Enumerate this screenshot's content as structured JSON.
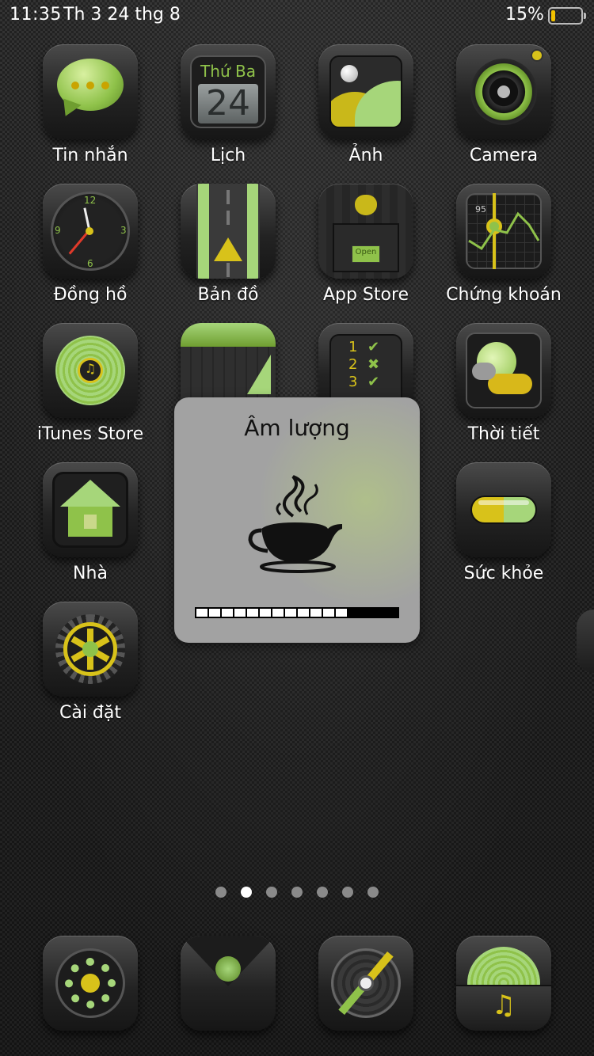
{
  "status_bar": {
    "time": "11:35",
    "date": "Th 3 24 thg 8",
    "battery_percent": "15%",
    "battery_level": 0.15
  },
  "apps": [
    {
      "label": "Tin nhắn",
      "icon": "messages-icon"
    },
    {
      "label": "Lịch",
      "icon": "calendar-icon",
      "day_name": "Thứ Ba",
      "day_number": "24"
    },
    {
      "label": "Ảnh",
      "icon": "photos-icon"
    },
    {
      "label": "Camera",
      "icon": "camera-icon"
    },
    {
      "label": "Đồng hồ",
      "icon": "clock-icon",
      "clock_numbers": [
        "12",
        "3",
        "6",
        "9"
      ]
    },
    {
      "label": "Bản đồ",
      "icon": "maps-icon"
    },
    {
      "label": "App Store",
      "icon": "app-store-icon",
      "sign_text": "Open"
    },
    {
      "label": "Chứng khoán",
      "icon": "stocks-icon",
      "value_text": "95"
    },
    {
      "label": "iTunes Store",
      "icon": "itunes-store-icon"
    },
    {
      "label": "",
      "icon": "notes-icon"
    },
    {
      "label": "",
      "icon": "reminders-icon",
      "list_numbers": [
        "1",
        "2",
        "3"
      ]
    },
    {
      "label": "Thời tiết",
      "icon": "weather-icon"
    },
    {
      "label": "Nhà",
      "icon": "home-icon"
    },
    {
      "label": "Sức khỏe",
      "icon": "health-icon"
    },
    {
      "label": "Cài đặt",
      "icon": "settings-icon"
    }
  ],
  "dock": [
    {
      "icon": "phone-icon"
    },
    {
      "icon": "mail-icon"
    },
    {
      "icon": "safari-icon"
    },
    {
      "icon": "music-icon"
    }
  ],
  "page_dots": {
    "count": 7,
    "active_index": 1
  },
  "volume_hud": {
    "title": "Âm lượng",
    "icon": "coffee-cup-icon",
    "level_segments": 12,
    "total_segments": 16
  },
  "colors": {
    "accent_green": "#8fc24a",
    "accent_yellow": "#d8c21a",
    "battery_fill": "#f2c200"
  }
}
